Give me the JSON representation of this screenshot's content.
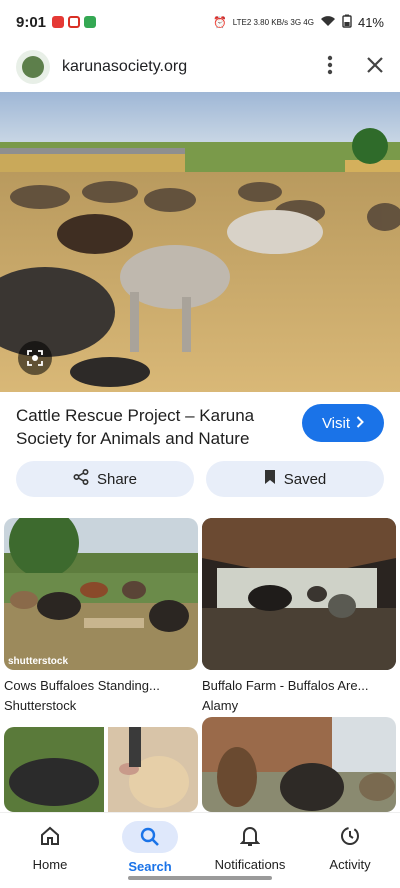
{
  "status": {
    "time": "9:01",
    "signal_text": "LTE2 3.80 KB/s 3G 4G",
    "battery": "41%"
  },
  "browser": {
    "domain": "karunasociety.org",
    "more_icon": "more-vert-icon",
    "close_icon": "close-icon"
  },
  "result": {
    "title": "Cattle Rescue Project – Karuna Society for Animals and Nature",
    "visit_label": "Visit",
    "share_label": "Share",
    "saved_label": "Saved"
  },
  "related": [
    {
      "caption": "Cows Buffaloes Standing...",
      "source": "Shutterstock",
      "watermark": "shutterstock"
    },
    {
      "caption": "Buffalo Farm - Buffalos Are...",
      "source": "Alamy",
      "watermark": ""
    },
    {
      "caption": "",
      "source": "",
      "watermark": ""
    },
    {
      "caption": "",
      "source": "",
      "watermark": ""
    }
  ],
  "nav": {
    "items": [
      {
        "label": "Home",
        "icon": "home-icon"
      },
      {
        "label": "Search",
        "icon": "search-icon"
      },
      {
        "label": "Notifications",
        "icon": "bell-icon"
      },
      {
        "label": "Activity",
        "icon": "activity-icon"
      }
    ]
  },
  "colors": {
    "accent": "#1a73e8",
    "pill_bg": "#e8eef9"
  }
}
